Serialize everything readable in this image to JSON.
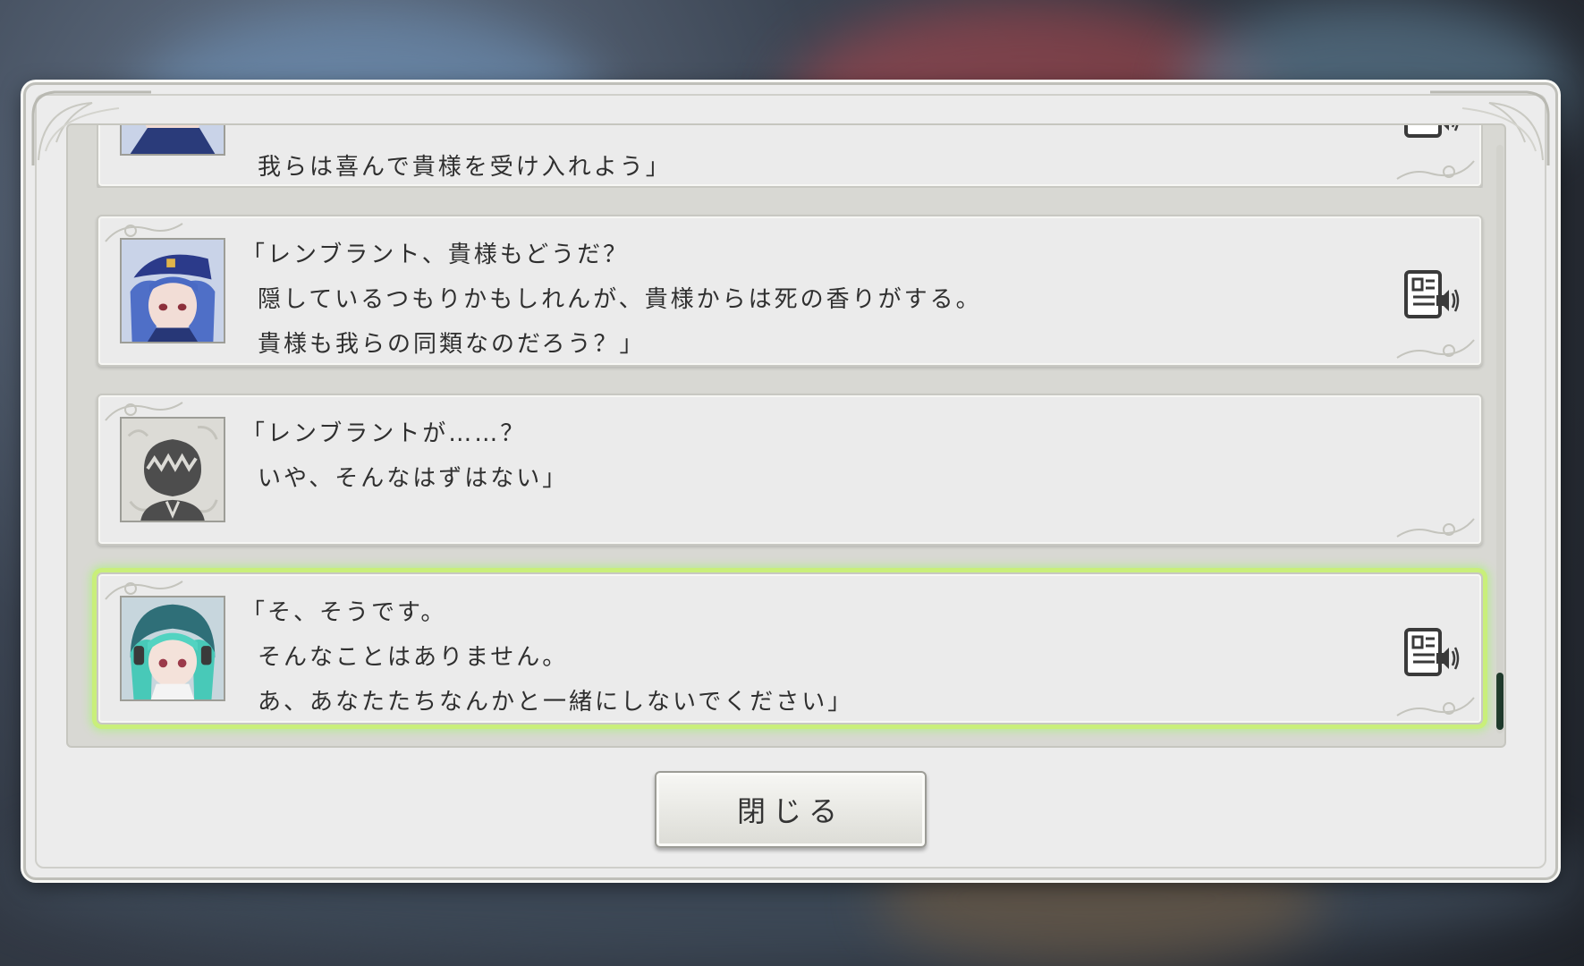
{
  "dialog": {
    "close_label": "閉じる"
  },
  "entries": [
    {
      "speaker_portrait": "blue-haired-officer-portrait",
      "lines": [
        "我らは喜んで貴様を受け入れよう」"
      ],
      "has_voice": true
    },
    {
      "speaker_portrait": "blue-haired-officer-portrait",
      "lines": [
        "「レンブラント、貴様もどうだ？",
        "隠しているつもりかもしれんが、貴様からは死の香りがする。",
        "貴様も我らの同類なのだろう？」"
      ],
      "has_voice": true
    },
    {
      "speaker_portrait": "silhouette-portrait",
      "lines": [
        "「レンブラントが……？",
        "いや、そんなはずはない」"
      ],
      "has_voice": false
    },
    {
      "speaker_portrait": "teal-haired-girl-portrait",
      "lines": [
        "「そ、そうです。",
        "そんなことはありません。",
        "あ、あなたたちなんかと一緒にしないでください」"
      ],
      "has_voice": true,
      "highlighted": true
    }
  ],
  "icons": {
    "voice": "voice-replay-icon",
    "corner": "ornament-corner-icon"
  },
  "colors": {
    "highlight_glow": "#c9ef7a",
    "scroll_thumb": "#1f3a2c",
    "panel_bg": "#ececec"
  }
}
